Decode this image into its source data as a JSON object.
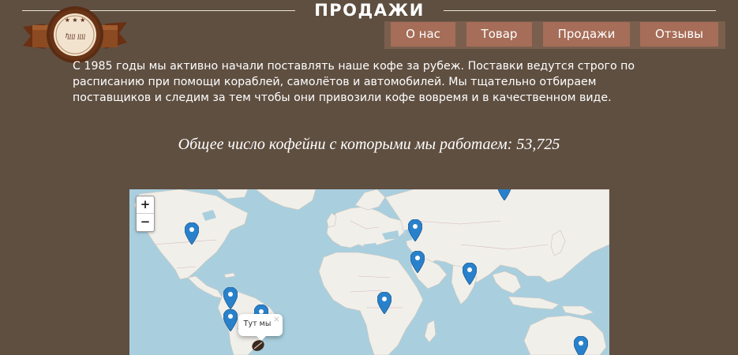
{
  "header": {
    "title": "ПРОДАЖИ",
    "logo_text": "ꝉꞁꞁꞁꞁ ꞁꞁꞁꞁ"
  },
  "nav": {
    "items": [
      "О нас",
      "Товар",
      "Продажи",
      "Отзывы"
    ]
  },
  "content": {
    "intro": "С 1985 годы мы активно начали поставлять наше кофе за рубеж. Поставки ведутся строго по расписанию при помощи кораблей, самолётов и автомобилей. Мы тщательно отбираем поставщиков и следим за тем чтобы они привозили кофе вовремя и в качественном виде.",
    "count_line": "Общее число кофейни с которыми мы работаем: 53,725"
  },
  "map": {
    "zoom_in": "+",
    "zoom_out": "−",
    "popup_text": "Тут мы",
    "popup_close": "×",
    "marker_icon": "map-marker",
    "colors": {
      "water": "#a9cfdf",
      "land": "#f1efe9",
      "marker": "#2a81cb"
    }
  },
  "colors": {
    "background": "#5f4f41",
    "nav_button": "#a66d58",
    "nav_strip": "#7a5f4e"
  }
}
